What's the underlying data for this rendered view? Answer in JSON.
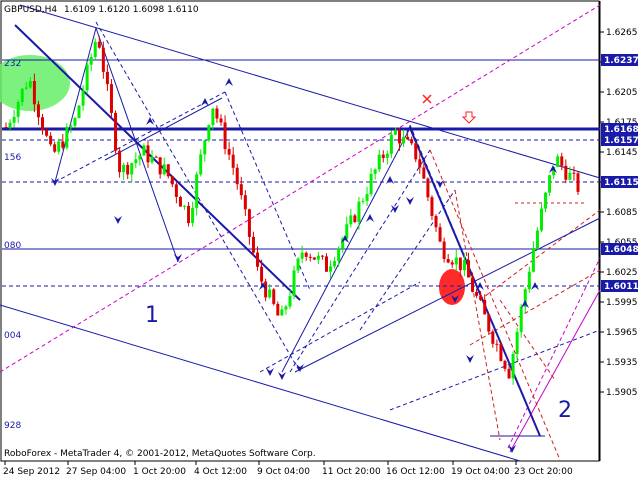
{
  "header": {
    "symbol_tf": "GBPUSD,H4",
    "ohlc": "1.6109 1.6120 1.6098 1.6110"
  },
  "footer": {
    "copyright": "RoboForex - MetaTrader 4, © 2001-2012, MetaQuotes Software Corp."
  },
  "wave_labels": [
    "1",
    "2"
  ],
  "fib_labels": [
    "232",
    "156",
    "080",
    "004",
    "928"
  ],
  "colors": {
    "background": "#ffffff",
    "bull_candle": "#00ee00",
    "bear_candle": "#dd0000",
    "trend_line": "#1a1aa8",
    "projection": "#cc00cc",
    "price_tag": "#1a1aa8",
    "annotation": "#ff2020"
  },
  "chart_data": {
    "type": "candlestick",
    "symbol": "GBPUSD",
    "timeframe": "H4",
    "ylim": [
      1.59,
      1.625
    ],
    "y_ticks": [
      "1.6265",
      "1.6235",
      "1.6205",
      "1.6175",
      "1.6145",
      "1.6115",
      "1.6085",
      "1.6055",
      "1.6025",
      "1.5995",
      "1.5965",
      "1.5935",
      "1.5905"
    ],
    "x_ticks": [
      "24 Sep 2012",
      "27 Sep 04:00",
      "1 Oct 20:00",
      "4 Oct 12:00",
      "9 Oct 04:00",
      "11 Oct 20:00",
      "16 Oct 12:00",
      "19 Oct 04:00",
      "23 Oct 20:00"
    ],
    "levels": [
      {
        "value": 1.6237,
        "label": "1.6237"
      },
      {
        "value": 1.6168,
        "label": "1.6168"
      },
      {
        "value": 1.6157,
        "label": "1.6157"
      },
      {
        "value": 1.6115,
        "label": "1.6115"
      },
      {
        "value": 1.6048,
        "label": "1.6048"
      },
      {
        "value": 1.6011,
        "label": "1.6011"
      }
    ],
    "close_path": [
      {
        "time": "24 Sep",
        "close": 1.617
      },
      {
        "time": "25 Sep",
        "close": 1.622
      },
      {
        "time": "26 Sep",
        "close": 1.614
      },
      {
        "time": "26 Sep",
        "close": 1.6175
      },
      {
        "time": "27 Sep",
        "close": 1.6265
      },
      {
        "time": "28 Sep",
        "close": 1.6125
      },
      {
        "time": "1 Oct",
        "close": 1.6145
      },
      {
        "time": "2 Oct",
        "close": 1.6125
      },
      {
        "time": "3 Oct",
        "close": 1.608
      },
      {
        "time": "4 Oct",
        "close": 1.6195
      },
      {
        "time": "5 Oct",
        "close": 1.6125
      },
      {
        "time": "8 Oct",
        "close": 1.6025
      },
      {
        "time": "9 Oct",
        "close": 1.5975
      },
      {
        "time": "10 Oct",
        "close": 1.605
      },
      {
        "time": "11 Oct",
        "close": 1.603
      },
      {
        "time": "12 Oct",
        "close": 1.607
      },
      {
        "time": "15 Oct",
        "close": 1.612
      },
      {
        "time": "16 Oct",
        "close": 1.6165
      },
      {
        "time": "17 Oct",
        "close": 1.614
      },
      {
        "time": "18 Oct",
        "close": 1.605
      },
      {
        "time": "19 Oct",
        "close": 1.603
      },
      {
        "time": "22 Oct",
        "close": 1.5975
      },
      {
        "time": "23 Oct",
        "close": 1.5925
      },
      {
        "time": "24 Oct",
        "close": 1.6045
      },
      {
        "time": "25 Oct",
        "close": 1.614
      },
      {
        "time": "26 Oct",
        "close": 1.611
      }
    ]
  }
}
